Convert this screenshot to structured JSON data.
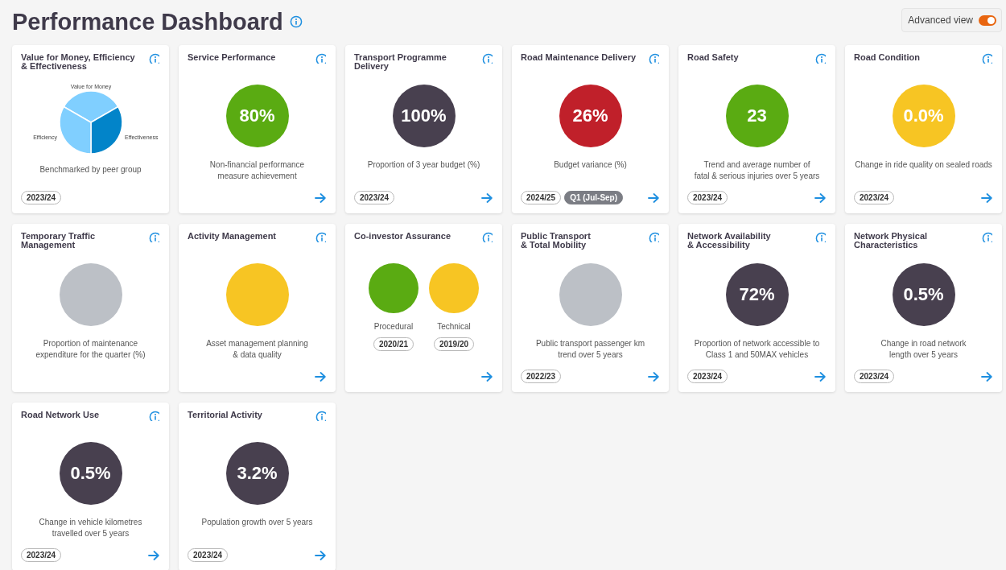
{
  "header": {
    "title": "Performance Dashboard",
    "advanced_view": {
      "label": "Advanced view",
      "on": true
    }
  },
  "cards": [
    {
      "kind": "pie",
      "title": "Value for Money, Efficiency\n& Effectiveness",
      "segments": [
        {
          "label": "Value for Money",
          "color": "#80cfff"
        },
        {
          "label": "Effectiveness",
          "color": "#0284c9"
        },
        {
          "label": "Efficiency",
          "color": "#80cfff"
        }
      ],
      "description": "Benchmarked by peer group",
      "badges": [
        {
          "text": "2023/24",
          "kind": "outline"
        }
      ],
      "arrow": false
    },
    {
      "kind": "metric",
      "title": "Service Performance",
      "value": "80%",
      "color": "#5aab12",
      "description": "Non-financial performance\nmeasure achievement",
      "arrow": true
    },
    {
      "kind": "metric",
      "title": "Transport Programme Delivery",
      "value": "100%",
      "color": "#48404f",
      "description": "Proportion of 3 year budget (%)",
      "badges": [
        {
          "text": "2023/24",
          "kind": "outline"
        }
      ],
      "arrow": true
    },
    {
      "kind": "metric",
      "title": "Road Maintenance Delivery",
      "value": "26%",
      "color": "#c0202a",
      "description": "Budget variance (%)",
      "badges": [
        {
          "text": "2024/25",
          "kind": "outline"
        },
        {
          "text": "Q1 (Jul-Sep)",
          "kind": "filled"
        }
      ],
      "arrow": true
    },
    {
      "kind": "metric",
      "title": "Road Safety",
      "value": "23",
      "color": "#5aab12",
      "description": "Trend and average number of\nfatal & serious injuries over 5 years",
      "badges": [
        {
          "text": "2023/24",
          "kind": "outline"
        }
      ],
      "arrow": true
    },
    {
      "kind": "metric",
      "title": "Road Condition",
      "value": "0.0%",
      "color": "#f7c523",
      "description": "Change in ride quality on sealed roads",
      "badges": [
        {
          "text": "2023/24",
          "kind": "outline"
        }
      ],
      "arrow": true
    },
    {
      "kind": "metric",
      "title": "Temporary Traffic\nManagement",
      "color": "#bcc0c6",
      "description": "Proportion of maintenance\nexpenditure for the quarter (%)",
      "arrow": false
    },
    {
      "kind": "metric",
      "title": "Activity Management",
      "color": "#f7c523",
      "description": "Asset management planning\n& data quality",
      "arrow": true
    },
    {
      "kind": "pair",
      "title": "Co-investor Assurance",
      "items": [
        {
          "label": "Procedural",
          "color": "#5aab12",
          "badge": "2020/21"
        },
        {
          "label": "Technical",
          "color": "#f7c523",
          "badge": "2019/20"
        }
      ],
      "arrow": true
    },
    {
      "kind": "metric",
      "title": "Public Transport\n& Total Mobility",
      "color": "#bcc0c6",
      "description": "Public transport passenger km\ntrend over 5 years",
      "badges": [
        {
          "text": "2022/23",
          "kind": "outline"
        }
      ],
      "arrow": true
    },
    {
      "kind": "metric",
      "title": "Network Availability\n& Accessibility",
      "value": "72%",
      "color": "#48404f",
      "description": "Proportion of network accessible to\nClass 1 and 50MAX vehicles",
      "badges": [
        {
          "text": "2023/24",
          "kind": "outline"
        }
      ],
      "arrow": true
    },
    {
      "kind": "metric",
      "title": "Network Physical\nCharacteristics",
      "value": "0.5%",
      "color": "#48404f",
      "description": "Change in road network\nlength over 5 years",
      "badges": [
        {
          "text": "2023/24",
          "kind": "outline"
        }
      ],
      "arrow": true
    },
    {
      "kind": "metric",
      "title": "Road Network Use",
      "value": "0.5%",
      "color": "#48404f",
      "description": "Change in vehicle kilometres\ntravelled over 5 years",
      "badges": [
        {
          "text": "2023/24",
          "kind": "outline"
        }
      ],
      "arrow": true
    },
    {
      "kind": "metric",
      "title": "Territorial Activity",
      "value": "3.2%",
      "color": "#48404f",
      "description": "Population growth over 5 years",
      "badges": [
        {
          "text": "2023/24",
          "kind": "outline"
        }
      ],
      "arrow": true
    }
  ]
}
